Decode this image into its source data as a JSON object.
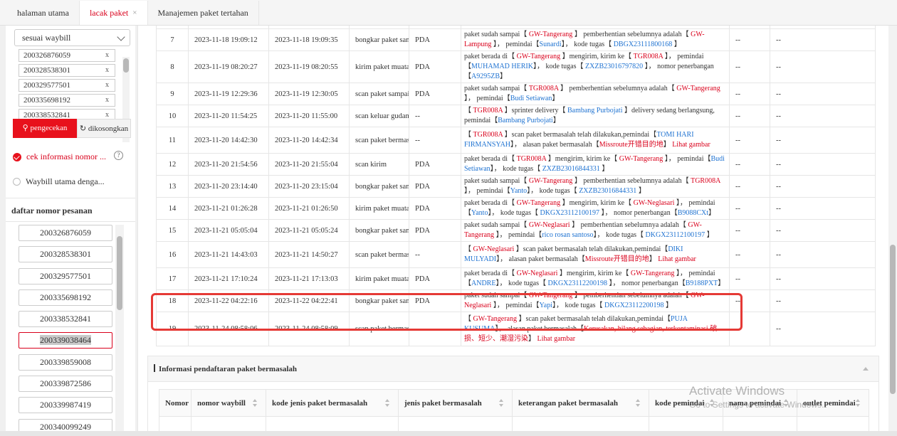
{
  "tabs": [
    {
      "label": "halaman utama"
    },
    {
      "label": "lacak paket",
      "close": "×"
    },
    {
      "label": "Manajemen paket tertahan"
    }
  ],
  "left": {
    "select_value": "sesuai waybill",
    "chips": [
      "200326876059",
      "200328538301",
      "200329577501",
      "200335698192",
      "200338532841"
    ],
    "chip_remove": "x",
    "search_button": "pengecekan",
    "search_icon": "search-icon",
    "clear_button": "dikosongkan",
    "option1": "cek informasi nomor ...",
    "option2": "Waybill utama denga...",
    "help": "?",
    "order_title": "daftar nomor pesanan",
    "orders": [
      "200326876059",
      "200328538301",
      "200329577501",
      "200335698192",
      "200338532841",
      "200339038464",
      "200339859008",
      "200339872586",
      "200339987419",
      "200340099249"
    ],
    "selected_order": "200339038464"
  },
  "tracking": {
    "partial_top": "",
    "rows": [
      {
        "no": "7",
        "t1": "2023-11-18 19:09:12",
        "t2": "2023-11-18 19:09:35",
        "type": "bongkar paket samp",
        "type_red": false,
        "source": "PDA",
        "desc": "paket sudah sampai【 <span class=\"red\">GW-Tangerang</span> 】 pemberhentian sebelumnya adalah【 <span class=\"red\">GW-Lampung</span> 】， pemindai【<span class=\"blue\">Sunardi</span>】， kode tugas【 <span class=\"blue\">DBGX23111800168</span> 】",
        "a": "--",
        "b": "--"
      },
      {
        "no": "8",
        "t1": "2023-11-19 08:20:27",
        "t2": "2023-11-19 08:20:55",
        "type": "kirim paket muatan",
        "type_red": false,
        "source": "PDA",
        "desc": "paket berada di【 <span class=\"red\">GW-Tangerang</span> 】mengirim, kirim ke【 <span class=\"red\">TGR008A</span> 】， pemindai【<span class=\"blue\">MUHAMAD HERIK</span>】， kode tugas【 <span class=\"blue\">ZXZB23016797820</span> 】， nomor penerbangan【<span class=\"blue\">A9295ZB</span>】",
        "a": "--",
        "b": "--"
      },
      {
        "no": "9",
        "t1": "2023-11-19 12:29:36",
        "t2": "2023-11-19 12:30:05",
        "type": "scan paket sampai",
        "type_red": false,
        "source": "PDA",
        "desc": "paket sudah sampai【 <span class=\"red\">TGR008A</span> 】 pemberhentian sebelumnya adalah【 <span class=\"red\">GW-Tangerang</span> 】， pemindai【<span class=\"blue\">Budi Setiawan</span>】",
        "a": "--",
        "b": "--"
      },
      {
        "no": "10",
        "t1": "2023-11-20 11:54:25",
        "t2": "2023-11-20 11:55:00",
        "type": "scan keluar gudang",
        "type_red": false,
        "source": "--",
        "desc": "【 <span class=\"red\">TGR008A</span> 】sprinter delivery【 <span class=\"blue\">Bambang Purbojati</span> 】delivery sedang berlangsung, pemindai【<span class=\"blue\">Bambang Purbojati</span>】",
        "a": "--",
        "b": "--"
      },
      {
        "no": "11",
        "t1": "2023-11-20 14:42:30",
        "t2": "2023-11-20 14:42:34",
        "type": "scan paket bermasa",
        "type_red": true,
        "source": "--",
        "desc": "【 <span class=\"red\">TGR008A</span> 】scan paket bermasalah telah dilakukan,pemindai【<span class=\"blue\">TOMI HARI FIRMANSYAH</span>】， alasan paket bermasalah【<span class=\"red\">Missroute开错目的地</span>】 <span class=\"red\">Lihat gambar</span>",
        "a": "--",
        "b": "--"
      },
      {
        "no": "12",
        "t1": "2023-11-20 21:54:56",
        "t2": "2023-11-20 21:55:04",
        "type": "scan kirim",
        "type_red": false,
        "source": "PDA",
        "desc": "paket berada di【 <span class=\"red\">TGR008A</span> 】mengirim, kirim ke【 <span class=\"red\">GW-Tangerang</span> 】， pemindai【<span class=\"blue\">Budi Setiawan</span>】， kode tugas【 <span class=\"blue\">ZXZB23016844331</span> 】",
        "a": "--",
        "b": "--"
      },
      {
        "no": "13",
        "t1": "2023-11-20 23:14:40",
        "t2": "2023-11-20 23:15:04",
        "type": "bongkar paket samp",
        "type_red": false,
        "source": "PDA",
        "desc": "paket sudah sampai【 <span class=\"red\">GW-Tangerang</span> 】 pemberhentian sebelumnya adalah【 <span class=\"red\">TGR008A</span> 】， pemindai【<span class=\"blue\">Yanto</span>】， kode tugas【 <span class=\"blue\">ZXZB23016844331</span> 】",
        "a": "--",
        "b": "--"
      },
      {
        "no": "14",
        "t1": "2023-11-21 01:26:28",
        "t2": "2023-11-21 01:26:50",
        "type": "kirim paket muatan",
        "type_red": false,
        "source": "PDA",
        "desc": "paket berada di【 <span class=\"red\">GW-Tangerang</span> 】mengirim, kirim ke【 <span class=\"red\">GW-Neglasari</span> 】， pemindai【<span class=\"blue\">Yanto</span>】， kode tugas【 <span class=\"blue\">DKGX23112100197</span> 】， nomor penerbangan【<span class=\"blue\">B9088CXt</span>】",
        "a": "--",
        "b": "--"
      },
      {
        "no": "15",
        "t1": "2023-11-21 05:05:04",
        "t2": "2023-11-21 05:05:24",
        "type": "bongkar paket samp",
        "type_red": false,
        "source": "PDA",
        "desc": "paket sudah sampai【 <span class=\"red\">GW-Neglasari</span> 】 pemberhentian sebelumnya adalah【 <span class=\"red\">GW-Tangerang</span> 】， pemindai【<span class=\"blue\">rico rosan santoso</span>】， kode tugas【 <span class=\"blue\">DKGX23112100197</span> 】",
        "a": "--",
        "b": "--"
      },
      {
        "no": "16",
        "t1": "2023-11-21 14:43:03",
        "t2": "2023-11-21 14:50:27",
        "type": "scan paket bermasa",
        "type_red": true,
        "source": "--",
        "desc": "【 <span class=\"red\">GW-Neglasari</span> 】scan paket bermasalah telah dilakukan,pemindai【<span class=\"blue\">DIKI MULYADI</span>】， alasan paket bermasalah【<span class=\"red\">Missroute开错目的地</span>】 <span class=\"red\">Lihat gambar</span>",
        "a": "--",
        "b": "--"
      },
      {
        "no": "17",
        "t1": "2023-11-21 17:10:24",
        "t2": "2023-11-21 17:13:03",
        "type": "kirim paket muatan",
        "type_red": false,
        "source": "PDA",
        "desc": "paket berada di【 <span class=\"red\">GW-Neglasari</span> 】mengirim, kirim ke【 <span class=\"red\">GW-Tangerang</span> 】， pemindai【<span class=\"blue\">ANDRE</span>】， kode tugas【 <span class=\"blue\">DKGX23112200198</span> 】， nomor penerbangan【<span class=\"blue\">B9188PXT</span>】",
        "a": "--",
        "b": "--"
      },
      {
        "no": "18",
        "t1": "2023-11-22 04:22:16",
        "t2": "2023-11-22 04:22:41",
        "type": "bongkar paket samp",
        "type_red": false,
        "source": "PDA",
        "desc": "paket sudah sampai【 <span class=\"red\">GW-Tangerang</span> 】 pemberhentian sebelumnya adalah【 <span class=\"red\">GW-Neglasari</span> 】， pemindai【<span class=\"blue\">Yapi</span>】， kode tugas【 <span class=\"blue\">DKGX23112200198</span> 】",
        "a": "--",
        "b": "--"
      },
      {
        "no": "19",
        "t1": "2023-11-24 08:58:06",
        "t2": "2023-11-24 08:58:09",
        "type": "scan paket bermasa",
        "type_red": true,
        "source": "--",
        "desc": "【 <span class=\"red\">GW-Tangerang</span> 】scan paket bermasalah telah dilakukan,pemindai【<span class=\"blue\">PUJA KUSUMA</span>】， alasan paket bermasalah【<span class=\"red\">Kerusakan, hilang sebagian, terkontaminasi 破损、短少、潮湿污染</span>】 <span class=\"red\">Lihat gambar</span>",
        "a": "--",
        "b": "--"
      }
    ]
  },
  "registration": {
    "title": "Informasi pendaftaran paket bermasalah",
    "columns": [
      "Nomor",
      "nomor waybill",
      "kode jenis paket bermasalah",
      "jenis paket bermasalah",
      "keterangan paket bermasalah",
      "kode pemindai",
      "nama pemindai",
      "outlet pemindai"
    ]
  },
  "watermark": {
    "line1": "Activate Windows",
    "line2": "Go to Settings to activate Windows."
  }
}
